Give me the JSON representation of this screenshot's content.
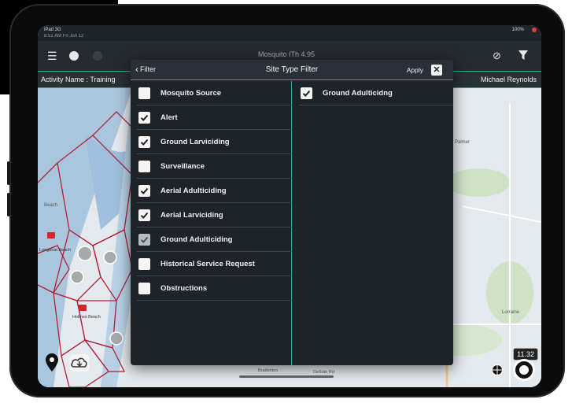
{
  "status_bar": {
    "device": "iPad 3G",
    "time": "8:51 AM  Fri Jun 12",
    "right": "100%"
  },
  "app_header": {
    "title": "Mosquito ITh 4.95"
  },
  "activity_bar": {
    "label": "Activity Name : Training",
    "user": "Michael Reynolds"
  },
  "filter_modal": {
    "back_label": "Filter",
    "title": "Site Type Filter",
    "apply_label": "Apply",
    "close_icon": "close-icon",
    "left_options": [
      {
        "label": "Mosquito Source",
        "checked": false
      },
      {
        "label": "Alert",
        "checked": true
      },
      {
        "label": "Ground Larviciding",
        "checked": true
      },
      {
        "label": "Surveillance",
        "checked": false
      },
      {
        "label": "Aerial Adulticiding",
        "checked": true
      },
      {
        "label": "Aerial Larviciding",
        "checked": true
      },
      {
        "label": "Ground Adulticiding",
        "checked": true,
        "dimmed": true
      },
      {
        "label": "Historical Service Request",
        "checked": false
      },
      {
        "label": "Obstructions",
        "checked": false
      }
    ],
    "right_options": [
      {
        "label": "Ground Adulticidng",
        "checked": true
      }
    ]
  },
  "map": {
    "labels": [
      "Beach",
      "Longboat Beach",
      "Holmes Beach",
      "Lorraine",
      "Palmer",
      "Bradenton",
      "DeSoto Rd"
    ],
    "zoom_badge": "11.32"
  },
  "colors": {
    "accent": "#3fa5a0",
    "modal_bg": "#1e2329",
    "boundary": "#b0203a"
  }
}
